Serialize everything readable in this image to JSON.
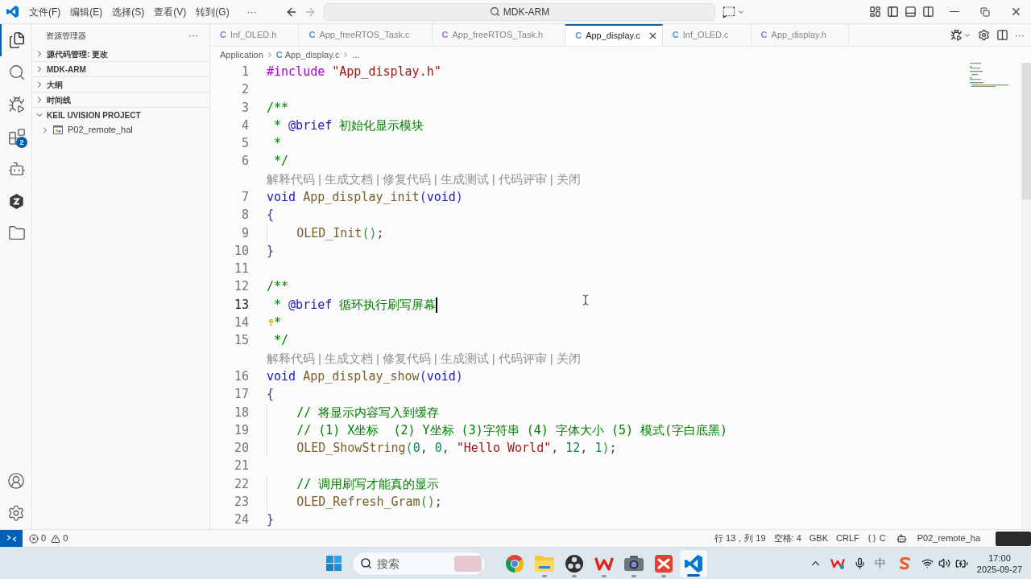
{
  "title_bar": {
    "menus": [
      "文件(F)",
      "编辑(E)",
      "选择(S)",
      "查看(V)",
      "转到(G)"
    ],
    "more": "···",
    "command_center": {
      "label": "MDK-ARM"
    }
  },
  "activity_bar": {
    "items": [
      {
        "kind": "explorer",
        "selected": true
      },
      {
        "kind": "search",
        "selected": false
      },
      {
        "kind": "run_debug",
        "selected": false
      },
      {
        "kind": "extensions",
        "selected": false,
        "badge": "2"
      },
      {
        "kind": "assistant",
        "selected": false
      },
      {
        "kind": "plugin",
        "selected": false
      },
      {
        "kind": "folder",
        "selected": false
      }
    ],
    "bottom": [
      {
        "kind": "account"
      },
      {
        "kind": "settings"
      }
    ]
  },
  "sidebar": {
    "title": "资源管理器",
    "more": "···",
    "sections": [
      {
        "label": "源代码管理: 更改",
        "expanded": false
      },
      {
        "label": "MDK-ARM",
        "expanded": false
      },
      {
        "label": "大纲",
        "expanded": false
      },
      {
        "label": "时间线",
        "expanded": false
      },
      {
        "label": "KEIL UVISION PROJECT",
        "expanded": true,
        "children": [
          {
            "label": "P02_remote_hal",
            "expanded": false
          }
        ]
      }
    ]
  },
  "tabs": [
    {
      "icon": "C",
      "label": "Inf_OLED.h",
      "color": "#a074c4",
      "selected": false
    },
    {
      "icon": "C",
      "label": "App_freeRTOS_Task.c",
      "color": "#519aba",
      "selected": false
    },
    {
      "icon": "C",
      "label": "App_freeRTOS_Task.h",
      "color": "#a074c4",
      "selected": false
    },
    {
      "icon": "C",
      "label": "App_display.c",
      "color": "#519aba",
      "selected": true
    },
    {
      "icon": "C",
      "label": "Inf_OLED.c",
      "color": "#519aba",
      "selected": false
    },
    {
      "icon": "C",
      "label": "App_display.h",
      "color": "#a074c4",
      "selected": false
    }
  ],
  "tab_actions": {
    "more": "···"
  },
  "breadcrumb": [
    {
      "label": "Application"
    },
    {
      "icon": "C",
      "label": "App_display.c"
    },
    {
      "label": "..."
    }
  ],
  "editor": {
    "lines": [
      {
        "kind": "code",
        "number": "1",
        "active": false,
        "lightbulb": false,
        "tokens": [
          {
            "kind": "preproc",
            "text": "#include "
          },
          {
            "kind": "string",
            "text": "\"App_display.h\""
          }
        ]
      },
      {
        "kind": "code",
        "number": "2",
        "active": false,
        "lightbulb": false
      },
      {
        "kind": "code",
        "number": "3",
        "active": false,
        "lightbulb": false,
        "tokens": [
          {
            "kind": "comment",
            "text": "/**"
          }
        ]
      },
      {
        "kind": "code",
        "number": "4",
        "active": false,
        "lightbulb": false,
        "tokens": [
          {
            "kind": "comment",
            "text": " * "
          },
          {
            "kind": "doctag",
            "text": "@brief"
          },
          {
            "kind": "comment",
            "text": " 初始化显示模块"
          }
        ]
      },
      {
        "kind": "code",
        "number": "5",
        "active": false,
        "lightbulb": false,
        "tokens": [
          {
            "kind": "comment",
            "text": " *"
          }
        ]
      },
      {
        "kind": "code",
        "number": "6",
        "active": false,
        "lightbulb": false,
        "tokens": [
          {
            "kind": "comment",
            "text": " */"
          }
        ]
      },
      {
        "kind": "codelens",
        "items": [
          "解释代码",
          "生成文档",
          "修复代码",
          "生成测试",
          "代码评审",
          "关闭"
        ],
        "separator": "|"
      },
      {
        "kind": "code",
        "number": "7",
        "active": false,
        "lightbulb": false,
        "tokens": [
          {
            "kind": "keyword",
            "text": "void "
          },
          {
            "kind": "function",
            "text": "App_display_init"
          },
          {
            "kind": "bracket",
            "text": "("
          },
          {
            "kind": "keyword",
            "text": "void"
          },
          {
            "kind": "bracket",
            "text": ")"
          }
        ]
      },
      {
        "kind": "code",
        "number": "8",
        "active": false,
        "lightbulb": false,
        "tokens": [
          {
            "kind": "bracket",
            "text": "{"
          }
        ]
      },
      {
        "kind": "code",
        "number": "9",
        "active": false,
        "lightbulb": false,
        "tokens": [
          {
            "kind": "function",
            "text": "    OLED_Init"
          },
          {
            "kind": "bracket2",
            "text": "()"
          },
          {
            "kind": "plain",
            "text": ";"
          }
        ]
      },
      {
        "kind": "code",
        "number": "10",
        "active": false,
        "lightbulb": false,
        "tokens": [
          {
            "kind": "bracket",
            "text": "}"
          }
        ]
      },
      {
        "kind": "code",
        "number": "11",
        "active": false,
        "lightbulb": false
      },
      {
        "kind": "code",
        "number": "12",
        "active": false,
        "lightbulb": false,
        "tokens": [
          {
            "kind": "comment",
            "text": "/**"
          }
        ]
      },
      {
        "kind": "code",
        "number": "13",
        "active": true,
        "lightbulb": false,
        "tokens": [
          {
            "kind": "comment",
            "text": " * "
          },
          {
            "kind": "doctag",
            "text": "@brief"
          },
          {
            "kind": "comment",
            "text": " 循环执行刷写屏幕"
          }
        ]
      },
      {
        "kind": "code",
        "number": "14",
        "active": false,
        "lightbulb": true,
        "tokens": [
          {
            "kind": "comment",
            "text": " *"
          }
        ]
      },
      {
        "kind": "code",
        "number": "15",
        "active": false,
        "lightbulb": false,
        "tokens": [
          {
            "kind": "comment",
            "text": " */"
          }
        ]
      },
      {
        "kind": "codelens",
        "items": [
          "解释代码",
          "生成文档",
          "修复代码",
          "生成测试",
          "代码评审",
          "关闭"
        ],
        "separator": "|"
      },
      {
        "kind": "code",
        "number": "16",
        "active": false,
        "lightbulb": false,
        "tokens": [
          {
            "kind": "keyword",
            "text": "void "
          },
          {
            "kind": "function",
            "text": "App_display_show"
          },
          {
            "kind": "bracket",
            "text": "("
          },
          {
            "kind": "keyword",
            "text": "void"
          },
          {
            "kind": "bracket",
            "text": ")"
          }
        ]
      },
      {
        "kind": "code",
        "number": "17",
        "active": false,
        "lightbulb": false,
        "tokens": [
          {
            "kind": "bracket",
            "text": "{"
          }
        ]
      },
      {
        "kind": "code",
        "number": "18",
        "active": false,
        "lightbulb": false,
        "tokens": [
          {
            "kind": "comment",
            "text": "    // 将显示内容写入到缓存"
          }
        ]
      },
      {
        "kind": "code",
        "number": "19",
        "active": false,
        "lightbulb": false,
        "tokens": [
          {
            "kind": "comment",
            "text": "    // (1) X坐标  (2) Y坐标 (3)字符串 (4) 字体大小 (5) 模式(字白底黑)"
          }
        ]
      },
      {
        "kind": "code",
        "number": "20",
        "active": false,
        "lightbulb": false,
        "tokens": [
          {
            "kind": "function",
            "text": "    OLED_ShowString"
          },
          {
            "kind": "bracket2",
            "text": "("
          },
          {
            "kind": "number",
            "text": "0"
          },
          {
            "kind": "plain",
            "text": ", "
          },
          {
            "kind": "number",
            "text": "0"
          },
          {
            "kind": "plain",
            "text": ", "
          },
          {
            "kind": "string",
            "text": "\"Hello World\""
          },
          {
            "kind": "plain",
            "text": ", "
          },
          {
            "kind": "number",
            "text": "12"
          },
          {
            "kind": "plain",
            "text": ", "
          },
          {
            "kind": "number",
            "text": "1"
          },
          {
            "kind": "bracket2",
            "text": ")"
          },
          {
            "kind": "plain",
            "text": ";"
          }
        ]
      },
      {
        "kind": "code",
        "number": "21",
        "active": false,
        "lightbulb": false
      },
      {
        "kind": "code",
        "number": "22",
        "active": false,
        "lightbulb": false,
        "tokens": [
          {
            "kind": "comment",
            "text": "    // 调用刷写才能真的显示"
          }
        ]
      },
      {
        "kind": "code",
        "number": "23",
        "active": false,
        "lightbulb": false,
        "tokens": [
          {
            "kind": "function",
            "text": "    OLED_Refresh_Gram"
          },
          {
            "kind": "bracket2",
            "text": "()"
          },
          {
            "kind": "plain",
            "text": ";"
          }
        ]
      },
      {
        "kind": "code",
        "number": "24",
        "active": false,
        "lightbulb": false,
        "tokens": [
          {
            "kind": "bracket",
            "text": "}"
          }
        ]
      }
    ]
  },
  "status_bar": {
    "errors": "0",
    "warnings": "0",
    "items": [
      {
        "kind": "text",
        "label": "行 13，列 19"
      },
      {
        "kind": "text",
        "label": "空格: 4"
      },
      {
        "kind": "text",
        "label": "GBK"
      },
      {
        "kind": "text",
        "label": "CRLF"
      },
      {
        "kind": "language",
        "label": "C"
      },
      {
        "kind": "assistant"
      },
      {
        "kind": "text",
        "label": "P02_remote_ha"
      },
      {
        "kind": "picture"
      }
    ]
  },
  "taskbar": {
    "search": {
      "placeholder": "搜索"
    },
    "apps": [
      {
        "kind": "browser",
        "selected": false,
        "running": false
      },
      {
        "kind": "files",
        "selected": false,
        "running": true
      },
      {
        "kind": "recorder",
        "selected": false,
        "running": true
      },
      {
        "kind": "office",
        "selected": false,
        "running": true
      },
      {
        "kind": "camera",
        "selected": false,
        "running": true
      },
      {
        "kind": "red_tile",
        "selected": false,
        "running": true
      },
      {
        "kind": "editor",
        "selected": true,
        "running": true
      }
    ],
    "tray": {
      "ime": "中"
    },
    "clock": {
      "time": "17:00",
      "date": "2025-09-27"
    }
  }
}
